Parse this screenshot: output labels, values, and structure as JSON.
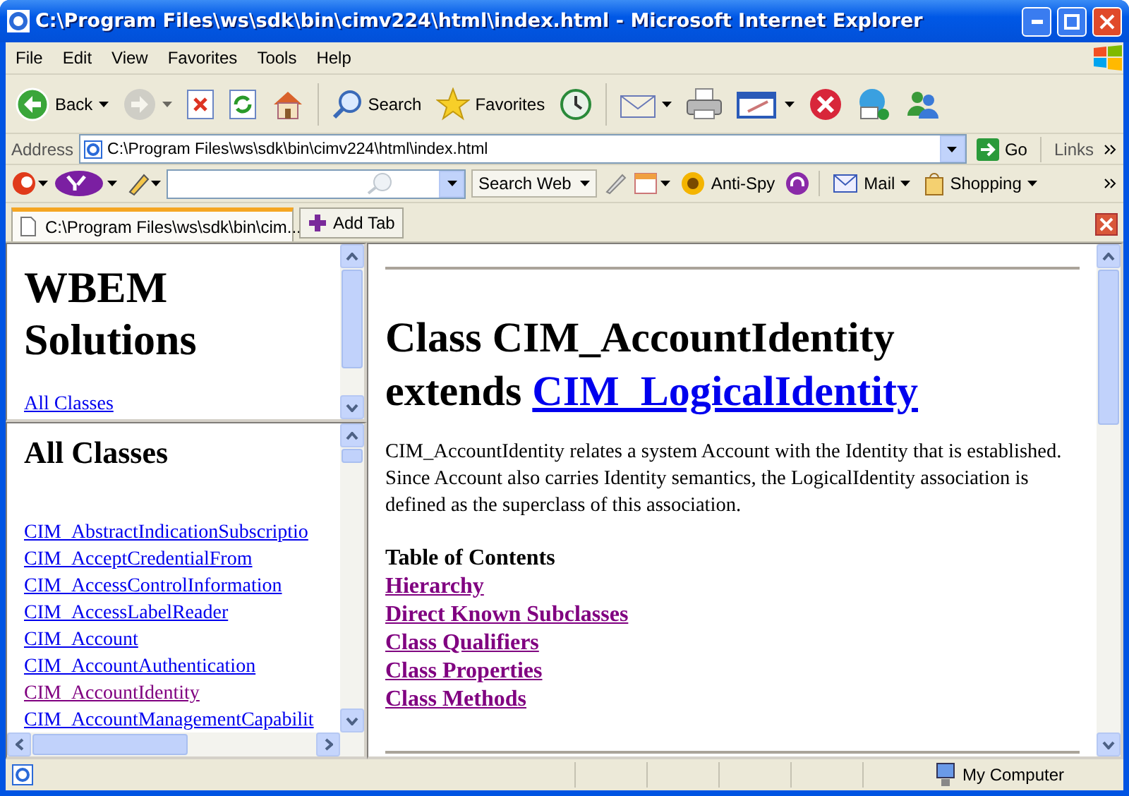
{
  "window": {
    "title": "C:\\Program Files\\ws\\sdk\\bin\\cimv224\\html\\index.html - Microsoft Internet Explorer"
  },
  "menu": [
    "File",
    "Edit",
    "View",
    "Favorites",
    "Tools",
    "Help"
  ],
  "toolbar": [
    {
      "label": "Back",
      "dropdown": true,
      "disabled": false
    },
    {
      "dropdown": true,
      "disabled": true
    },
    {
      "disabled": false
    },
    {
      "disabled": false
    },
    {
      "disabled": false
    },
    {
      "label": "Search",
      "disabled": false
    },
    {
      "label": "Favorites",
      "disabled": false
    },
    {
      "disabled": false
    },
    {
      "dropdown": true,
      "disabled": false
    },
    {
      "disabled": false
    },
    {
      "dropdown": true,
      "disabled": false
    },
    {
      "disabled": false
    },
    {
      "disabled": false
    },
    {
      "disabled": false
    }
  ],
  "address": {
    "label": "Address",
    "value": "C:\\Program Files\\ws\\sdk\\bin\\cimv224\\html\\index.html",
    "go": "Go",
    "links": "Links"
  },
  "search_bar": {
    "search_button": "Search Web",
    "items": [
      {
        "label": "Anti-Spy"
      },
      {
        "label": "Mail",
        "dropdown": true
      },
      {
        "label": "Shopping",
        "dropdown": true
      }
    ]
  },
  "tabs": [
    {
      "label": "C:\\Program Files\\ws\\sdk\\bin\\cim...",
      "selected": true
    }
  ],
  "add_tab": "Add Tab",
  "top_frame": {
    "heading": "WBEM Solutions",
    "link": "All Classes"
  },
  "class_frame": {
    "heading": "All Classes",
    "links": [
      {
        "label": "CIM_AbstractIndicationSubscriptio",
        "visited": false
      },
      {
        "label": "CIM_AcceptCredentialFrom",
        "visited": false
      },
      {
        "label": "CIM_AccessControlInformation",
        "visited": false
      },
      {
        "label": "CIM_AccessLabelReader",
        "visited": false
      },
      {
        "label": "CIM_Account",
        "visited": false
      },
      {
        "label": "CIM_AccountAuthentication",
        "visited": false
      },
      {
        "label": "CIM_AccountIdentity",
        "visited": true
      },
      {
        "label": "CIM_AccountManagementCapabilit",
        "visited": false
      }
    ]
  },
  "main": {
    "title": "Class CIM_AccountIdentity",
    "extends": "extends",
    "superclass": "CIM_LogicalIdentity",
    "description": "CIM_AccountIdentity relates a system Account with the Identity that is established. Since Account also carries Identity semantics, the LogicalIdentity association is defined as the superclass of this association.",
    "toc_title": "Table of Contents",
    "toc": [
      {
        "label": "Hierarchy",
        "visited": true
      },
      {
        "label": "Direct Known Subclasses",
        "visited": true
      },
      {
        "label": "Class Qualifiers",
        "visited": true
      },
      {
        "label": "Class Properties",
        "visited": true
      },
      {
        "label": "Class Methods",
        "visited": true
      }
    ]
  },
  "status_bar": {
    "zone": "My Computer"
  }
}
